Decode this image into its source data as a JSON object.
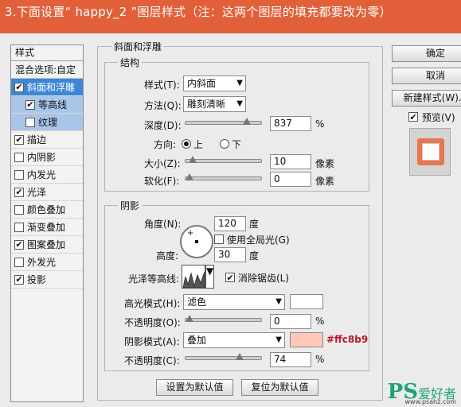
{
  "banner": {
    "title": "3.下面设置“ happy_2 ”图层样式（注：这两个图层的填充都要改为零）"
  },
  "left_list": {
    "header": "样式",
    "blend_options": "混合选项:自定",
    "items": [
      {
        "label": "斜面和浮雕",
        "checked": true,
        "selected": true
      },
      {
        "label": "等高线",
        "checked": true,
        "sub": true
      },
      {
        "label": "纹理",
        "checked": false,
        "sub": true
      },
      {
        "label": "描边",
        "checked": true
      },
      {
        "label": "内阴影",
        "checked": false
      },
      {
        "label": "内发光",
        "checked": false
      },
      {
        "label": "光泽",
        "checked": true
      },
      {
        "label": "颜色叠加",
        "checked": false
      },
      {
        "label": "渐变叠加",
        "checked": false
      },
      {
        "label": "图案叠加",
        "checked": true
      },
      {
        "label": "外发光",
        "checked": false
      },
      {
        "label": "投影",
        "checked": true
      }
    ]
  },
  "bevel": {
    "section_title": "斜面和浮雕",
    "structure_title": "结构",
    "style_label": "样式(T):",
    "style_value": "内斜面",
    "technique_label": "方法(Q):",
    "technique_value": "雕刻清晰",
    "depth_label": "深度(D):",
    "depth_value": "837",
    "depth_unit": "%",
    "depth_level": 0.85,
    "direction_label": "方向:",
    "dir_up": "上",
    "dir_down": "下",
    "size_label": "大小(Z):",
    "size_value": "10",
    "size_unit": "像素",
    "size_level": 0.05,
    "soften_label": "软化(F):",
    "soften_value": "0",
    "soften_unit": "像素",
    "soften_level": 0.0
  },
  "shading": {
    "title": "阴影",
    "angle_label": "角度(N):",
    "angle_value": "120",
    "angle_unit": "度",
    "global_light_label": "使用全局光(G)",
    "global_light_checked": false,
    "altitude_label": "高度:",
    "altitude_value": "30",
    "altitude_unit": "度",
    "gloss_contour_label": "光泽等高线:",
    "anti_alias_label": "消除锯齿(L)",
    "anti_alias_checked": true,
    "highlight_mode_label": "高光模式(H):",
    "highlight_mode_value": "滤色",
    "highlight_color": "#ffffff",
    "highlight_opacity_label": "不透明度(O):",
    "highlight_opacity_value": "0",
    "highlight_opacity_unit": "%",
    "highlight_opacity_level": 0.0,
    "shadow_mode_label": "阴影模式(A):",
    "shadow_mode_value": "叠加",
    "shadow_color": "#ffc8b9",
    "shadow_color_note": "#ffc8b9",
    "shadow_opacity_label": "不透明度(C):",
    "shadow_opacity_value": "74",
    "shadow_opacity_unit": "%",
    "shadow_opacity_level": 0.74
  },
  "bottom_buttons": {
    "make_default": "设置为默认值",
    "reset_default": "复位为默认值"
  },
  "right": {
    "ok": "确定",
    "cancel": "取消",
    "new_style": "新建样式(W)...",
    "preview_label": "预览(V)",
    "preview_checked": true
  },
  "watermark": {
    "ps": "PS",
    "cn": "爱好者",
    "url": "www.psahz.com"
  },
  "colors": {
    "banner": "#e1603a",
    "selection": "#3a87d6",
    "sub_selection": "#a9c6ea",
    "note_red": "#b0192a",
    "preview_orange": "#e8764f"
  }
}
